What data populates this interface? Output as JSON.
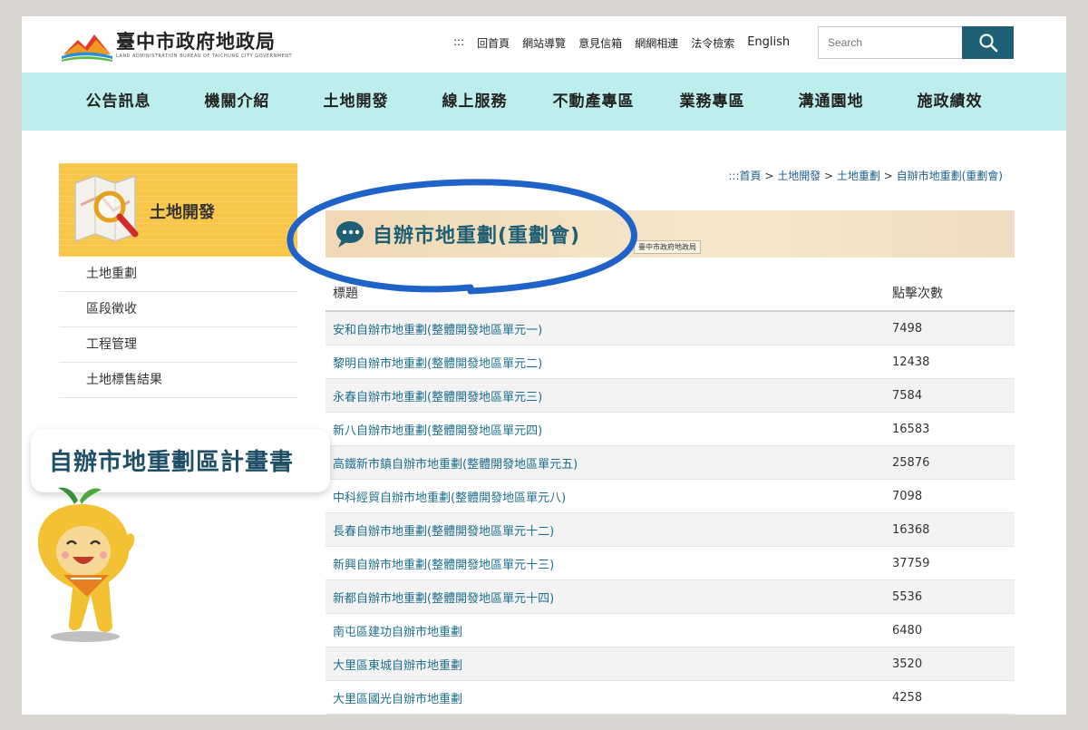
{
  "header": {
    "logo_title": "臺中市政府地政局",
    "logo_subtitle": "LAND ADMINISTRATION BUREAU OF TAICHUNG CITY GOVERNMENT",
    "top_links": [
      ":::",
      "回首頁",
      "網站導覽",
      "意見信箱",
      "網網相連",
      "法令檢索"
    ],
    "english_link": "English",
    "search_placeholder": "Search"
  },
  "nav": {
    "items": [
      "公告訊息",
      "機關介紹",
      "土地開發",
      "線上服務",
      "不動產專區",
      "業務專區",
      "溝通園地",
      "施政績效"
    ]
  },
  "sidebar": {
    "title": "土地開發",
    "items": [
      "土地重劃",
      "區段徵收",
      "工程管理",
      "土地標售結果"
    ]
  },
  "breadcrumb": {
    "prefix": ":::",
    "items": [
      "首頁",
      "土地開發",
      "土地重劃",
      "自辦市地重劃(重劃會)"
    ]
  },
  "main": {
    "title": "自辦市地重劃(重劃會)",
    "org_tag": "臺中市政府地政局",
    "table": {
      "headers": [
        "標題",
        "點擊次數"
      ],
      "rows": [
        {
          "title": "安和自辦市地重劃(整體開發地區單元一)",
          "clicks": "7498"
        },
        {
          "title": "黎明自辦市地重劃(整體開發地區單元二)",
          "clicks": "12438"
        },
        {
          "title": "永春自辦市地重劃(整體開發地區單元三)",
          "clicks": "7584"
        },
        {
          "title": "新八自辦市地重劃(整體開發地區單元四)",
          "clicks": "16583"
        },
        {
          "title": "高鐵新市鎮自辦市地重劃(整體開發地區單元五)",
          "clicks": "25876"
        },
        {
          "title": "中科經貿自辦市地重劃(整體開發地區單元八)",
          "clicks": "7098"
        },
        {
          "title": "長春自辦市地重劃(整體開發地區單元十二)",
          "clicks": "16368"
        },
        {
          "title": "新興自辦市地重劃(整體開發地區單元十三)",
          "clicks": "37759"
        },
        {
          "title": "新都自辦市地重劃(整體開發地區單元十四)",
          "clicks": "5536"
        },
        {
          "title": "南屯區建功自辦市地重劃",
          "clicks": "6480"
        },
        {
          "title": "大里區東城自辦市地重劃",
          "clicks": "3520"
        },
        {
          "title": "大里區國光自辦市地重劃",
          "clicks": "4258"
        }
      ]
    }
  },
  "annotation": {
    "note_text": "自辦市地重劃區計畫書"
  },
  "colors": {
    "nav_bg": "#bdeeee",
    "accent": "#1f5f74",
    "sidebar_head": "#f8c74a",
    "ellipse": "#1f63c9"
  }
}
